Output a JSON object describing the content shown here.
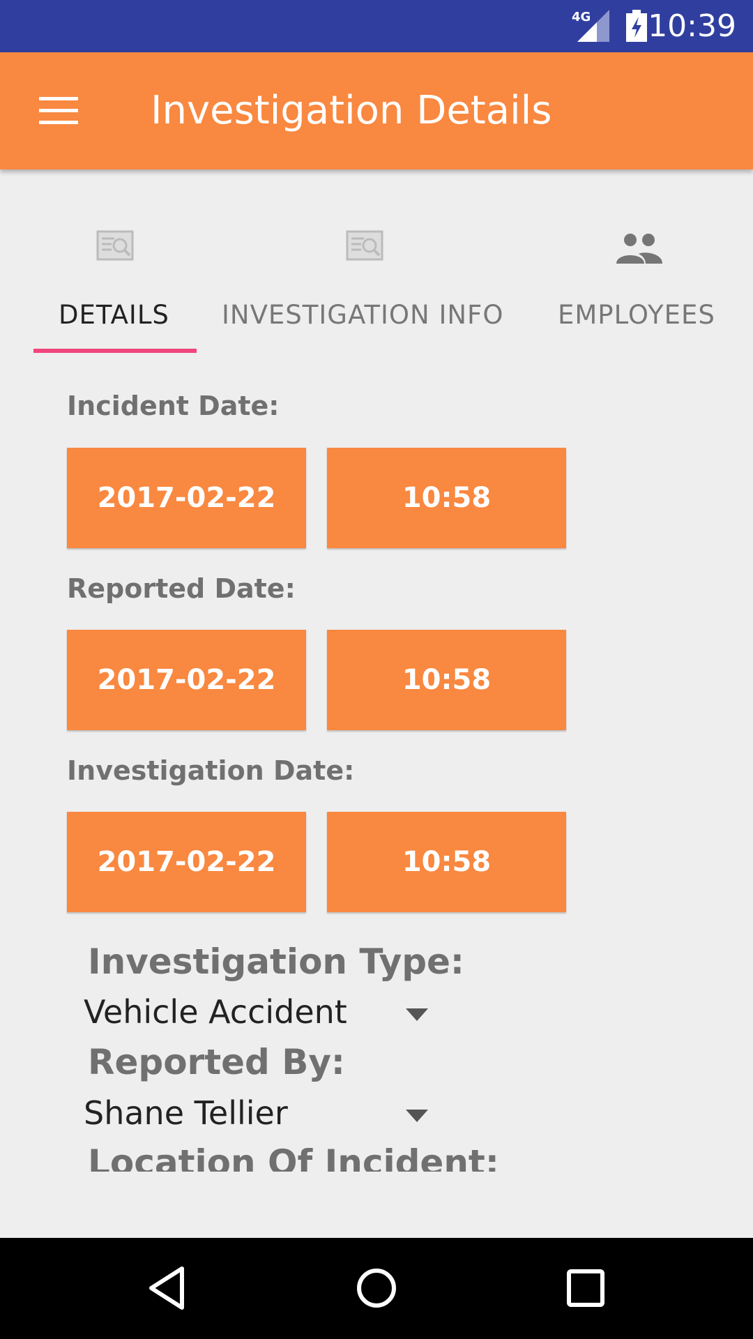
{
  "status_bar": {
    "network": "4G",
    "time": "10:39"
  },
  "app_bar": {
    "title": "Investigation Details"
  },
  "tabs": [
    {
      "label": "DETAILS",
      "icon": "document-search-icon",
      "active": true
    },
    {
      "label": "INVESTIGATION INFO",
      "icon": "document-search-icon",
      "active": false
    },
    {
      "label": "EMPLOYEES",
      "icon": "people-icon",
      "active": false
    }
  ],
  "dates": [
    {
      "label": "Incident Date:",
      "date": "2017-02-22",
      "time": "10:58"
    },
    {
      "label": "Reported Date:",
      "date": "2017-02-22",
      "time": "10:58"
    },
    {
      "label": "Investigation Date:",
      "date": "2017-02-22",
      "time": "10:58"
    }
  ],
  "investigation_type": {
    "label": "Investigation Type:",
    "value": "Vehicle Accident"
  },
  "reported_by": {
    "label": "Reported By:",
    "value": "Shane Tellier"
  },
  "location": {
    "label": "Location Of Incident:"
  },
  "colors": {
    "status_bar": "#303f9f",
    "accent": "#f98840",
    "tab_indicator": "#f0457d",
    "background": "#eeeeee"
  }
}
